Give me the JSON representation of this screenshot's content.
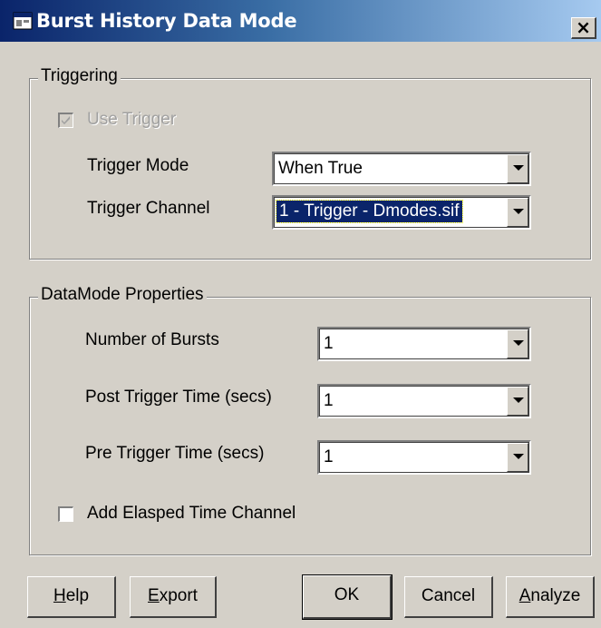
{
  "window": {
    "title": "Burst History Data Mode",
    "close_label": "×"
  },
  "triggering": {
    "legend": "Triggering",
    "use_trigger": {
      "label": "Use Trigger",
      "checked": true,
      "enabled": false
    },
    "trigger_mode": {
      "label": "Trigger Mode",
      "value": "When True"
    },
    "trigger_channel": {
      "label": "Trigger Channel",
      "value": "1 - Trigger - Dmodes.sif"
    }
  },
  "datamode": {
    "legend": "DataMode Properties",
    "number_of_bursts": {
      "label": "Number of Bursts",
      "value": "1"
    },
    "post_trigger_time": {
      "label": "Post Trigger Time (secs)",
      "value": "1"
    },
    "pre_trigger_time": {
      "label": "Pre Trigger Time (secs)",
      "value": "1"
    },
    "add_elapsed_time": {
      "label": "Add Elasped Time Channel",
      "checked": false
    }
  },
  "buttons": {
    "help": {
      "mnemonic": "H",
      "rest": "elp"
    },
    "export": {
      "mnemonic": "E",
      "rest": "xport"
    },
    "ok": "OK",
    "cancel": "Cancel",
    "analyze": {
      "mnemonic": "A",
      "rest": "nalyze"
    }
  }
}
